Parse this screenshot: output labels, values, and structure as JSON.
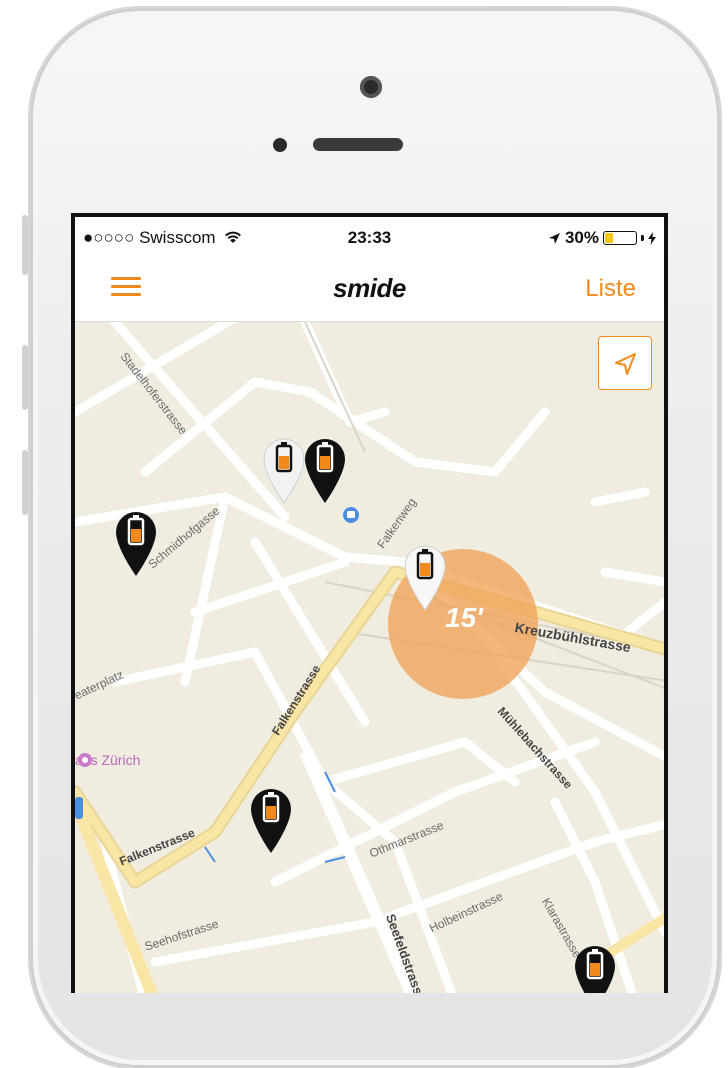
{
  "status": {
    "carrier": "●○○○○ Swisscom",
    "time": "23:33",
    "battery": "30%",
    "battery_level": 0.3
  },
  "nav": {
    "logo": "smide",
    "list_label": "Liste"
  },
  "map": {
    "streets": {
      "stadelhoferstrasse": "Stadelhoferstrasse",
      "schmidhofgasse": "Schmidhofgasse",
      "falkenweg": "Falkenweg",
      "kreuzbuehlstrasse": "Kreuzbühlstrasse",
      "theaterplatz": "eaterplatz",
      "falkenstrasse_a": "Falkenstrasse",
      "falkenstrasse_b": "Falkenstrasse",
      "muehlebachstrasse": "Mühlebachstrasse",
      "othmarstrasse": "Othmarstrasse",
      "seehofstrasse": "Seehofstrasse",
      "holbeinstrasse": "Holbeinstrasse",
      "seefeldstrasse": "Seefeldstrass",
      "klarastrasse": "Klarastrasse"
    },
    "poi_label": "aus Zürich",
    "walk_time": "15'"
  },
  "colors": {
    "accent": "#f28a1b",
    "map_bg": "#f1ece0",
    "radius_fill": "#f0a45a",
    "main_road": "#f9e6a5"
  },
  "icons": {
    "menu": "hamburger-menu-icon",
    "locate": "location-arrow-icon",
    "wifi": "wifi-icon",
    "location_services": "location-arrow-status-icon",
    "charging": "lightning-bolt-icon",
    "bike_pin": "battery-pin-icon"
  }
}
